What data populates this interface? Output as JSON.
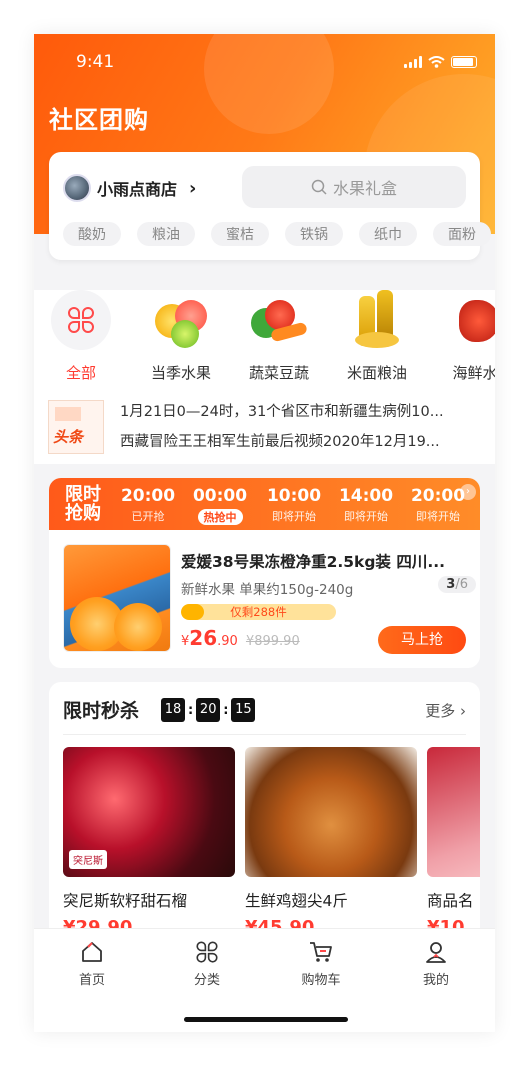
{
  "status_bar": {
    "time": "9:41"
  },
  "header": {
    "title": "社区团购"
  },
  "store": {
    "name": "小雨点商店",
    "search_placeholder": "水果礼盒"
  },
  "tags": [
    "酸奶",
    "粮油",
    "蜜桔",
    "铁锅",
    "纸巾",
    "面粉"
  ],
  "categories": [
    {
      "label": "全部",
      "icon": "grid-icon",
      "active": true
    },
    {
      "label": "当季水果",
      "icon": "fruit-icon"
    },
    {
      "label": "蔬菜豆蔬",
      "icon": "vegetable-icon"
    },
    {
      "label": "米面粮油",
      "icon": "oil-icon"
    },
    {
      "label": "海鲜水",
      "icon": "seafood-icon"
    }
  ],
  "news": {
    "logo_text": "头条",
    "lines": [
      "1月21日0—24时，31个省区市和新疆生病例10...",
      "西藏冒险王王相军生前最后视频2020年12月19..."
    ]
  },
  "flash_sale": {
    "label_line1": "限时",
    "label_line2": "抢购",
    "slots": [
      {
        "time": "20:00",
        "status": "已开抢"
      },
      {
        "time": "00:00",
        "status": "热抢中",
        "active": true
      },
      {
        "time": "10:00",
        "status": "即将开始"
      },
      {
        "time": "14:00",
        "status": "即将开始"
      },
      {
        "time": "20:00",
        "status": "即将开始"
      }
    ],
    "product": {
      "title": "爱媛38号果冻橙净重2.5kg装 四川...",
      "subtitle": "新鲜水果 单果约150g-240g",
      "page_current": "3",
      "page_total": "/6",
      "stock_text": "仅剩288件",
      "stock_fraction": 0.15,
      "price_symbol": "¥",
      "price_int": "26",
      "price_dec": ".90",
      "orig_price": "¥899.90",
      "buy_label": "马上抢"
    }
  },
  "seckill": {
    "title": "限时秒杀",
    "timer": [
      "18",
      "20",
      "15"
    ],
    "more": "更多",
    "items": [
      {
        "name": "突尼斯软籽甜石榴",
        "price": "¥29.90",
        "img_caption": "突尼斯"
      },
      {
        "name": "生鲜鸡翅尖4斤",
        "price": "¥45.90"
      },
      {
        "name": "商品名",
        "price": "¥10"
      }
    ]
  },
  "tabbar": [
    {
      "label": "首页",
      "icon": "home-icon"
    },
    {
      "label": "分类",
      "icon": "category-icon"
    },
    {
      "label": "购物车",
      "icon": "cart-icon"
    },
    {
      "label": "我的",
      "icon": "user-icon"
    }
  ],
  "colors": {
    "primary": "#ff5a1a",
    "accent": "#ff3b30",
    "gold": "#ffb22a"
  }
}
